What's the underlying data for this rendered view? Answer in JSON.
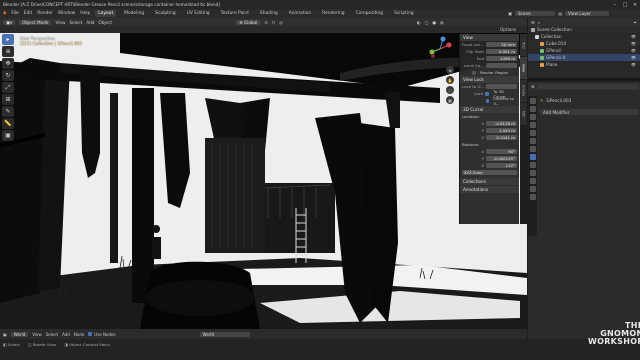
{
  "titlebar": {
    "title": "Blender [A:Z Drive\\CONCEPT ART\\Blender Grease Pencil scenes\\storage container homestead 6c.blend]",
    "minimize": "–",
    "maximize": "□",
    "close": "×"
  },
  "menu": {
    "items": [
      "File",
      "Edit",
      "Render",
      "Window",
      "Help"
    ],
    "workspaces": [
      "Layout",
      "Modeling",
      "Sculpting",
      "UV Editing",
      "Texture Paint",
      "Shading",
      "Animation",
      "Rendering",
      "Compositing",
      "Scripting"
    ],
    "active_workspace": "Layout",
    "scene_label": "Scene",
    "view_layer_label": "View Layer"
  },
  "header3d": {
    "mode": "Object Mode",
    "menus": [
      "View",
      "Select",
      "Add",
      "Object"
    ],
    "orientation": "Global",
    "options": "Options"
  },
  "viewport": {
    "view_name": "User Perspective",
    "collection_info": "(221) Collection | GPencil.003"
  },
  "npanel": {
    "view_header": "View",
    "focal_length_label": "Focal Len...",
    "focal_length": "50 mm",
    "clip_start_label": "Clip Start",
    "clip_start": "0.001 m",
    "clip_end_label": "End",
    "clip_end": "1498 m",
    "local_camera_label": "Local Ca...",
    "render_region": "Render Region",
    "view_lock": "View Lock",
    "lock_to_obj_label": "Lock to O...",
    "lock_label": "Lock",
    "to_3d_cursor": "To 3D Cursor",
    "camera_to_view": "Camera to V...",
    "cursor_header": "3D Cursor",
    "location_label": "Location:",
    "loc_x_label": "X",
    "loc_x": "-0.8128 m",
    "loc_y_label": "Y",
    "loc_y": "1.053 m",
    "loc_z_label": "Z",
    "loc_z": "0.3441 m",
    "rotation_label": "Rotation:",
    "rot_x_label": "X",
    "rot_x": "90°",
    "rot_y_label": "Y",
    "rot_y": "-0.000155°",
    "rot_z_label": "Z",
    "rot_z": "132°",
    "rotation_mode": "XYZ Euler",
    "collections_header": "Collections",
    "annotations_header": "Annotations"
  },
  "vtabs": [
    "Tool",
    "View",
    "Create",
    "Edit"
  ],
  "outliner": {
    "title": "Scene Collection",
    "rows": [
      {
        "name": "Collection",
        "color": "#d8d8d8"
      },
      {
        "name": "Cube.014",
        "color": "#e8a050"
      },
      {
        "name": "GPencil",
        "color": "#70c070"
      },
      {
        "name": "GPencil.0",
        "color": "#70c070"
      },
      {
        "name": "Plane",
        "color": "#e8a050"
      }
    ]
  },
  "properties": {
    "object_name": "GPencil.003",
    "add_modifier": "Add Modifier"
  },
  "timeline": {
    "items": [
      "World",
      "View",
      "Select",
      "Add",
      "Node",
      "Use Nodes"
    ],
    "world_field": "World"
  },
  "status": {
    "items": [
      "Select",
      "Rotate View",
      "Object Context Menu"
    ]
  },
  "watermark": {
    "line1": "THE GNOMON",
    "line2": "WORKSHOP"
  }
}
